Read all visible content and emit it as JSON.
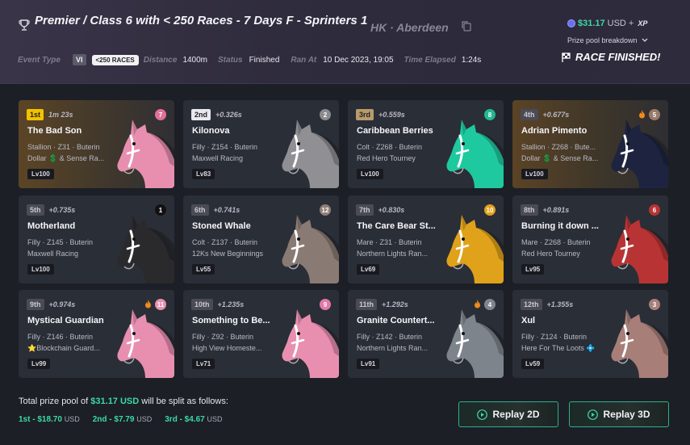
{
  "header": {
    "title": "Premier / Class 6 with < 250 Races - 7 Days F - Sprinters 1",
    "location": "HK · Aberdeen",
    "prize_amount": "$31.17",
    "prize_currency": "USD",
    "prize_plus": "+",
    "prize_xp": "XP",
    "prize_breakdown": "Prize pool breakdown",
    "event_type_label": "Event Type",
    "event_type_value": "VI",
    "races_pill": "<250 RACES",
    "distance_label": "Distance",
    "distance_value": "1400m",
    "status_label": "Status",
    "status_value": "Finished",
    "ran_at_label": "Ran At",
    "ran_at_value": "10 Dec 2023, 19:05",
    "elapsed_label": "Time Elapsed",
    "elapsed_value": "1:24s",
    "finished_text": "RACE FINISHED!"
  },
  "horses": [
    {
      "pos": "1st",
      "gap": "1m 23s",
      "name": "The Bad Son",
      "line1": "Stallion · Z31 · Buterin",
      "line2": "Dollar 💲 & Sense Ra...",
      "level": "Lv100",
      "number": "7",
      "num_color": "#e0709a",
      "horse_color": "#e88fb0",
      "fire": false
    },
    {
      "pos": "2nd",
      "gap": "+0.326s",
      "name": "Kilonova",
      "line1": "Filly · Z154 · Buterin",
      "line2": "Maxwell Racing",
      "level": "Lv83",
      "number": "2",
      "num_color": "#8a8a8f",
      "horse_color": "#8f8f94",
      "fire": false
    },
    {
      "pos": "3rd",
      "gap": "+0.559s",
      "name": "Caribbean Berries",
      "line1": "Colt · Z268 · Buterin",
      "line2": "Red Hero Tourney",
      "level": "Lv100",
      "number": "8",
      "num_color": "#22b890",
      "horse_color": "#1fc9a0",
      "fire": false
    },
    {
      "pos": "4th",
      "gap": "+0.677s",
      "name": "Adrian Pimento",
      "line1": "Stallion · Z268 · Bute...",
      "line2": "Dollar 💲 & Sense Ra...",
      "level": "Lv100",
      "number": "5",
      "num_color": "#9a7a68",
      "horse_color": "#1e2440",
      "fire": true
    },
    {
      "pos": "5th",
      "gap": "+0.735s",
      "name": "Motherland",
      "line1": "Filly · Z145 · Buterin",
      "line2": "Maxwell Racing",
      "level": "Lv100",
      "number": "1",
      "num_color": "#111111",
      "horse_color": "#2a2a2c",
      "fire": false
    },
    {
      "pos": "6th",
      "gap": "+0.741s",
      "name": "Stoned Whale",
      "line1": "Colt · Z137 · Buterin",
      "line2": "12Ks New Beginnings",
      "level": "Lv55",
      "number": "12",
      "num_color": "#8f7f78",
      "horse_color": "#8a7a74",
      "fire": false
    },
    {
      "pos": "7th",
      "gap": "+0.830s",
      "name": "The Care Bear St...",
      "line1": "Mare · Z31 · Buterin",
      "line2": "Northern Lights Ran...",
      "level": "Lv69",
      "number": "10",
      "num_color": "#e0a21a",
      "horse_color": "#e0a21a",
      "fire": false
    },
    {
      "pos": "8th",
      "gap": "+0.891s",
      "name": "Burning it down ...",
      "line1": "Mare · Z268 · Buterin",
      "line2": "Red Hero Tourney",
      "level": "Lv95",
      "number": "6",
      "num_color": "#b83434",
      "horse_color": "#b83434",
      "fire": false
    },
    {
      "pos": "9th",
      "gap": "+0.974s",
      "name": "Mystical Guardian",
      "line1": "Filly · Z146 · Buterin",
      "line2": "⭐Blockchain Guard...",
      "level": "Lv99",
      "number": "11",
      "num_color": "#e890b0",
      "horse_color": "#e88fb0",
      "fire": true
    },
    {
      "pos": "10th",
      "gap": "+1.235s",
      "name": "Something to Be...",
      "line1": "Filly · Z92 · Buterin",
      "line2": "High View Homeste...",
      "level": "Lv71",
      "number": "9",
      "num_color": "#e07aa6",
      "horse_color": "#e88fb0",
      "fire": false
    },
    {
      "pos": "11th",
      "gap": "+1.292s",
      "name": "Granite Countert...",
      "line1": "Filly · Z142 · Buterin",
      "line2": "Northern Lights Ran...",
      "level": "Lv91",
      "number": "4",
      "num_color": "#80858d",
      "horse_color": "#7e848c",
      "fire": true
    },
    {
      "pos": "12th",
      "gap": "+1.355s",
      "name": "Xul",
      "line1": "Filly · Z124 · Buterin",
      "line2": "Here For The Loots 💠",
      "level": "Lv59",
      "number": "3",
      "num_color": "#a8807a",
      "horse_color": "#a87e78",
      "fire": false
    }
  ],
  "footer": {
    "total_prefix": "Total prize pool of",
    "total_amount": "$31.17 USD",
    "total_suffix": "will be split as follows:",
    "splits": [
      {
        "label": "1st - $18.70",
        "cur": "USD"
      },
      {
        "label": "2nd - $7.79",
        "cur": "USD"
      },
      {
        "label": "3rd - $4.67",
        "cur": "USD"
      }
    ],
    "replay_2d": "Replay 2D",
    "replay_3d": "Replay 3D"
  }
}
